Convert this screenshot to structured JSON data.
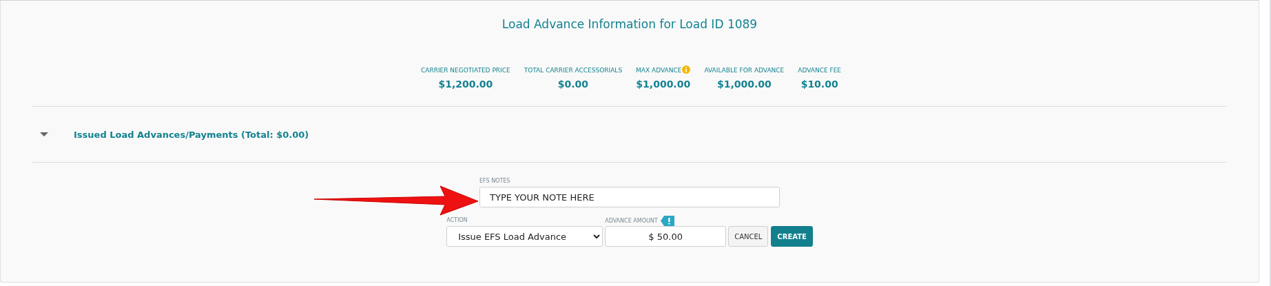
{
  "title": "Load Advance Information for Load ID 1089",
  "stats": [
    {
      "label": "CARRIER NEGOTIATED PRICE",
      "value": "$1,200.00",
      "info": false
    },
    {
      "label": "TOTAL CARRIER ACCESSORIALS",
      "value": "$0.00",
      "info": false
    },
    {
      "label": "MAX ADVANCE",
      "value": "$1,000.00",
      "info": true
    },
    {
      "label": "AVAILABLE FOR ADVANCE",
      "value": "$1,000.00",
      "info": false
    },
    {
      "label": "ADVANCE FEE",
      "value": "$10.00",
      "info": false
    }
  ],
  "section": {
    "label": "Issued Load Advances/Payments (Total: $0.00)",
    "expanded": true
  },
  "form": {
    "notes": {
      "label": "EFS NOTES",
      "value": "TYPE YOUR NOTE HERE"
    },
    "action": {
      "label": "ACTION",
      "value": "Issue EFS Load Advance"
    },
    "amount": {
      "label": "ADVANCE AMOUNT",
      "value": "$ 50.00",
      "warning": true
    },
    "buttons": [
      {
        "label": "CANCEL",
        "kind": "secondary"
      },
      {
        "label": "CREATE",
        "kind": "primary"
      }
    ]
  }
}
